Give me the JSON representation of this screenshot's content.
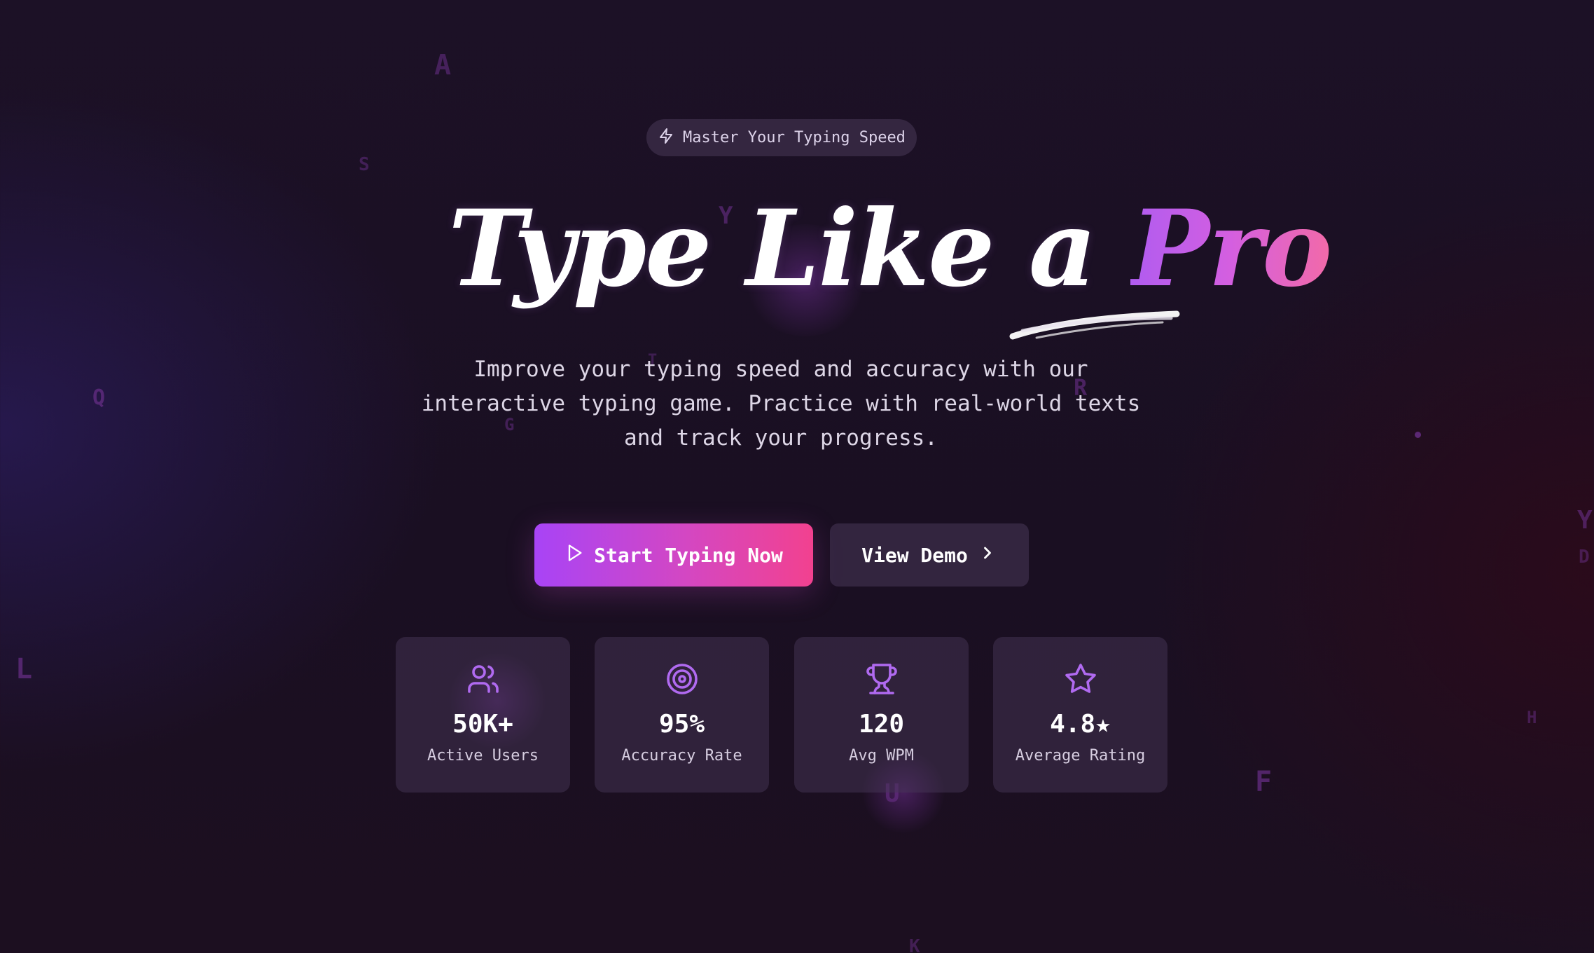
{
  "badge": {
    "icon": "zap-icon",
    "label": "Master Your Typing Speed"
  },
  "headline": {
    "part1": "Type Like a",
    "part2": "Pro"
  },
  "subtitle": "Improve your typing speed and accuracy with our interactive typing game. Practice with real-world texts and track your progress.",
  "buttons": {
    "primary": {
      "icon": "play-icon",
      "label": "Start Typing Now"
    },
    "secondary": {
      "label": "View Demo",
      "icon": "chevron-right-icon"
    }
  },
  "stats": [
    {
      "icon": "users-icon",
      "value": "50K+",
      "label": "Active Users"
    },
    {
      "icon": "target-icon",
      "value": "95%",
      "label": "Accuracy Rate"
    },
    {
      "icon": "trophy-icon",
      "value": "120",
      "label": "Avg WPM"
    },
    {
      "icon": "star-icon",
      "value": "4.8★",
      "label": "Average Rating"
    }
  ],
  "floating_letters": [
    "A",
    "S",
    "Y",
    "Q",
    "T",
    "G",
    "R",
    "L",
    "U",
    "F",
    "H",
    "Y",
    "D",
    "K"
  ],
  "colors": {
    "accent_start": "#a844f6",
    "accent_end": "#f2418f",
    "icon_color": "#b06af0",
    "background": "#1c1126"
  }
}
